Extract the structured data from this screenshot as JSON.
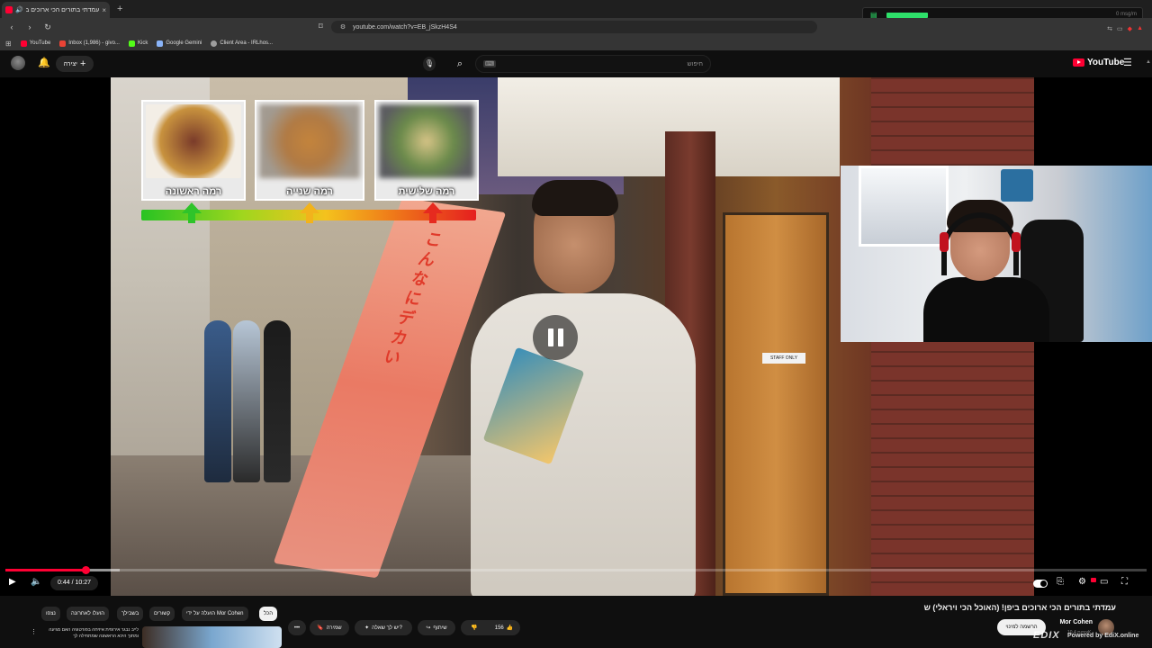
{
  "browser": {
    "tab_title": "עמדתי בתורים הכי ארוכים ביפ",
    "tab_close": "×",
    "new_tab": "+",
    "url": "youtube.com/watch?v=EB_jSkzH4S4",
    "bookmarks": [
      {
        "label": "YouTube",
        "color": "#ff0033"
      },
      {
        "label": "Inbox (1,986) - givo...",
        "color": "#ea4335"
      },
      {
        "label": "Kick",
        "color": "#53fc18"
      },
      {
        "label": "Google Gemini",
        "color": "#8ab4f8"
      },
      {
        "label": "Client Area - IRLhos...",
        "color": "#9e9e9e"
      }
    ],
    "extension_text": "0 msg/m"
  },
  "header": {
    "create_label": "יצירה",
    "search_placeholder": "חיפוש",
    "logo_text": "YouTube"
  },
  "video": {
    "thumbnail_overlay": {
      "ranks": [
        {
          "label": "רמה ראשונה"
        },
        {
          "label": "רמה שנייה"
        },
        {
          "label": "רמה שלישית"
        }
      ],
      "arrow_colors": [
        "#2ec42a",
        "#f2b31c",
        "#e62a1f"
      ]
    },
    "banner_text": "こんなにデカい",
    "sign_text": "STAFF ONLY"
  },
  "player": {
    "current_time": "0:44",
    "duration": "10:27",
    "time_display": "0:44 / 10:27",
    "progress_fraction": 0.0701,
    "buffer_fraction": 0.1,
    "accent_color": "#ff0033"
  },
  "details": {
    "title": "עמדתי בתורים הכי ארוכים ביפן! (האוכל הכי ויראלי) ש",
    "channel_name": "Mor Cohen",
    "channel_subs": "צפיות 10.4K",
    "subscribe_label": "הרשמה למינוי",
    "like_count": "156",
    "share_label": "שיתוף",
    "ask_label": "יש לך שאלה?",
    "save_label": "שמירה",
    "more_label": "•••"
  },
  "chips": [
    {
      "label": "הכל",
      "active": true
    },
    {
      "label": "הועלה על ידי Mor Cohen",
      "active": false
    },
    {
      "label": "קשורים",
      "active": false
    },
    {
      "label": "בשבילך",
      "active": false
    },
    {
      "label": "הועלו לאחרונה",
      "active": false
    },
    {
      "label": "נצפו",
      "active": false
    }
  ],
  "recommendation": {
    "text": "לייב נבגר אירופית איזיחה בפורטוגיה האם מגיעה ומתוך היכא הראשונה שמתחילה לך"
  },
  "watermark": {
    "brand": "EDIX",
    "powered": "Powered by EdiX.online"
  }
}
